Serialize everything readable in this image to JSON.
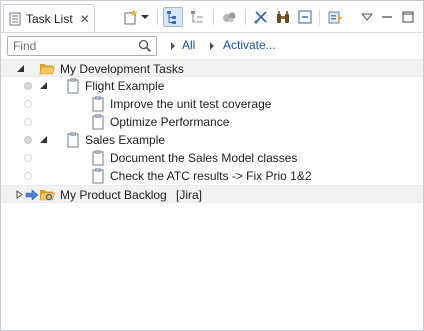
{
  "view": {
    "tab_label": "Task List",
    "tab_close": "✕"
  },
  "filter": {
    "find_placeholder": "Find",
    "all_label": "All",
    "activate_label": "Activate..."
  },
  "tree": {
    "dev_tasks": "My Development Tasks",
    "flight_example": "Flight Example",
    "improve_tests": "Improve the unit test coverage",
    "optimize_perf": "Optimize Performance",
    "sales_example": "Sales Example",
    "document_sales": "Document the Sales Model classes",
    "check_atc": "Check the ATC results -> Fix Prio 1&2",
    "product_backlog": "My Product Backlog",
    "backlog_tag": "[Jira]"
  },
  "colors": {
    "folder": "#e8b640",
    "link": "#1a4fa0",
    "selection": "#f2f2f2"
  }
}
